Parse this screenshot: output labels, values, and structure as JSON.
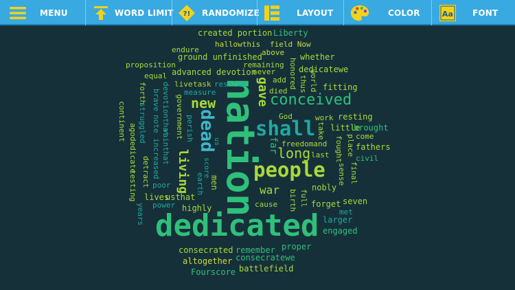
{
  "toolbar": {
    "menu": {
      "label": "MENU",
      "icon": "hamburger-icon"
    },
    "word_limit": {
      "label": "WORD LIMIT",
      "icon": "arrow-up-icon"
    },
    "randomize": {
      "label": "RANDOMIZE",
      "icon": "dice-icon",
      "glyph": "?!"
    },
    "layout": {
      "label": "LAYOUT",
      "icon": "layout-icon"
    },
    "color": {
      "label": "COLOR",
      "icon": "palette-icon"
    },
    "font": {
      "label": "FONT",
      "icon": "font-icon",
      "glyph": "Aa"
    }
  },
  "colors": {
    "toolbar": "#38a9e1",
    "background": "#16303a",
    "icon_yellow": "#f3d21a",
    "words": [
      "#a8d93a",
      "#2fc07a",
      "#1ea99e",
      "#3fb6c7",
      "#6ad04a",
      "#c8de3a"
    ]
  },
  "words": [
    "nation",
    "dedicated",
    "people",
    "shall",
    "dead",
    "conceived",
    "new",
    "living",
    "gave",
    "long",
    "war",
    "far",
    "created portion",
    "Liberty",
    "hallowthis",
    "field Now",
    "endure",
    "ground unfinished",
    "above",
    "whether",
    "proposition",
    "remaining",
    "honored",
    "equal",
    "advanced devotion",
    "never",
    "dedicatewe",
    "live",
    "task",
    "resolve",
    "add",
    "thus",
    "world",
    "fitting",
    "measure",
    "died",
    "forth",
    "struggled",
    "brave",
    "note",
    "increased",
    "devotionthat",
    "vainthat",
    "government",
    "perish",
    "continent",
    "ago",
    "dedicate",
    "testing",
    "detract",
    "poor",
    "God",
    "work",
    "resting",
    "take",
    "little",
    "brought",
    "come",
    "freedomand",
    "fought",
    "place",
    "fathers",
    "civil",
    "last",
    "sense",
    "final",
    "earth",
    "men",
    "nobly",
    "lives",
    "usthat",
    "power",
    "highly",
    "cause",
    "full",
    "birth",
    "forget",
    "seven",
    "years",
    "met",
    "larger",
    "engaged",
    "consecrated",
    "remember",
    "proper",
    "altogether",
    "consecratewe",
    "Fourscore",
    "battlefield",
    "score",
    "us"
  ]
}
